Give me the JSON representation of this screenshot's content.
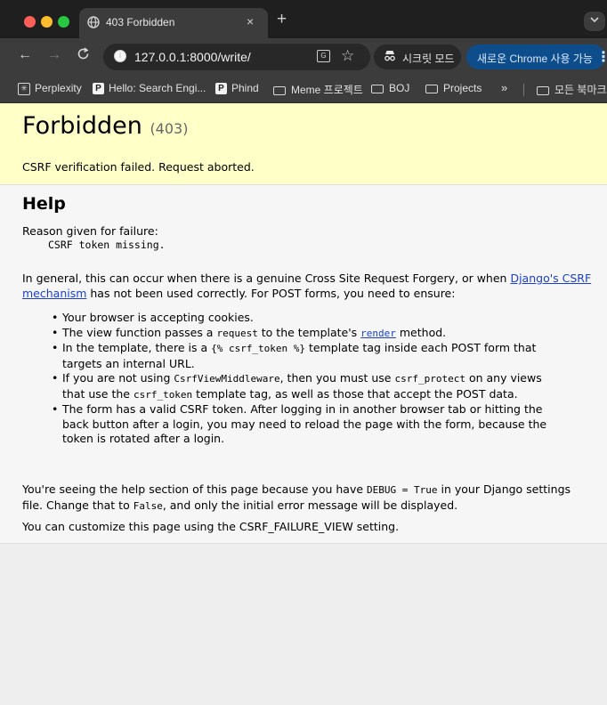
{
  "tab": {
    "title": "403 Forbidden",
    "close": "×",
    "new_tab": "+"
  },
  "toolbar": {
    "url": "127.0.0.1:8000/write/",
    "incognito_label": "시크릿 모드",
    "update_label": "새로운 Chrome 사용 가능"
  },
  "bookmarks": {
    "items": [
      "Perplexity",
      "Hello: Search Engi...",
      "Phind",
      "Meme 프로젝트",
      "BOJ",
      "Projects"
    ],
    "overflow": "»",
    "all_bookmarks": "모든 북마크"
  },
  "summary": {
    "title": "Forbidden",
    "code": "(403)",
    "message": "CSRF verification failed. Request aborted."
  },
  "help": {
    "heading": "Help",
    "reason_label": "Reason given for failure:",
    "reason": "CSRF token missing.",
    "intro_before": "In general, this can occur when there is a genuine Cross Site Request Forgery, or when ",
    "intro_link": "Django's CSRF mechanism",
    "intro_after": " has not been used correctly. For POST forms, you need to ensure:",
    "item1": "Your browser is accepting cookies.",
    "item2_a": "The view function passes a ",
    "item2_code": "request",
    "item2_b": " to the template's ",
    "item2_link": "render",
    "item2_c": " method.",
    "item3_a": "In the template, there is a ",
    "item3_code": "{% csrf_token %}",
    "item3_b": " template tag inside each POST form that targets an internal URL.",
    "item4_a": "If you are not using ",
    "item4_code1": "CsrfViewMiddleware",
    "item4_b": ", then you must use ",
    "item4_code2": "csrf_protect",
    "item4_c": " on any views that use the ",
    "item4_code3": "csrf_token",
    "item4_d": " template tag, as well as those that accept the POST data.",
    "item5": "The form has a valid CSRF token. After logging in in another browser tab or hitting the back button after a login, you may need to reload the page with the form, because the token is rotated after a login.",
    "debug_a": "You're seeing the help section of this page because you have ",
    "debug_code1": "DEBUG = True",
    "debug_b": " in your Django settings file. Change that to ",
    "debug_code2": "False",
    "debug_c": ", and only the initial error message will be displayed.",
    "customize": "You can customize this page using the CSRF_FAILURE_VIEW setting."
  }
}
